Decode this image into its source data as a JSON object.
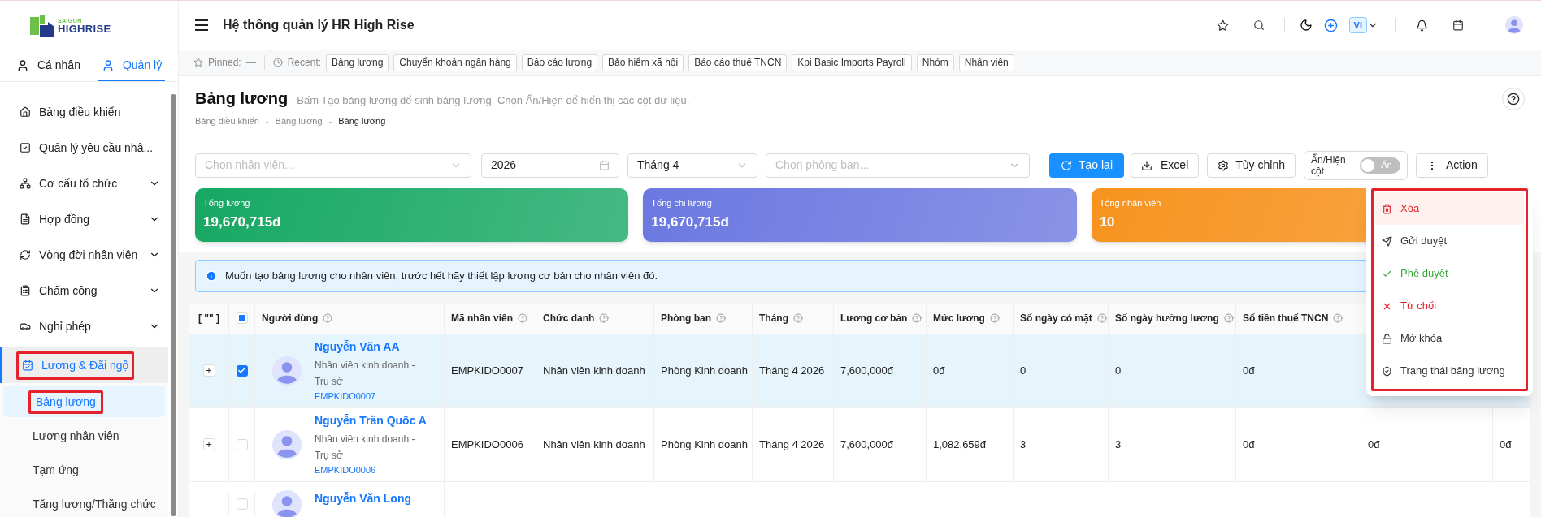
{
  "sidebar": {
    "logo": {
      "line1": "SAIGON",
      "line2": "HIGHRISE"
    },
    "tabs": [
      {
        "label": "Cá nhân",
        "selected": false
      },
      {
        "label": "Quản lý",
        "selected": true
      }
    ],
    "items": [
      {
        "label": "Bảng điều khiển"
      },
      {
        "label": "Quản lý yêu cầu nhâ...",
        "expanded": false
      },
      {
        "label": "Cơ cấu tổ chức",
        "expanded": false
      },
      {
        "label": "Hợp đồng",
        "expanded": false
      },
      {
        "label": "Vòng đời nhân viên",
        "expanded": false
      },
      {
        "label": "Chấm công",
        "expanded": false
      },
      {
        "label": "Nghỉ phép",
        "expanded": false
      },
      {
        "label": "Lương & Đãi ngộ",
        "expanded": true,
        "children": [
          {
            "label": "Bảng lương",
            "selected": true
          },
          {
            "label": "Lương nhân viên",
            "selected": false
          },
          {
            "label": "Tạm ứng",
            "selected": false
          },
          {
            "label": "Tăng lương/Thăng chức",
            "selected": false
          }
        ]
      }
    ]
  },
  "header": {
    "title": "Hệ thống quản lý HR High Rise",
    "language": "VI"
  },
  "pinned": {
    "label": "Pinned:",
    "value": "—"
  },
  "recent": {
    "label": "Recent:",
    "items": [
      "Bảng lương",
      "Chuyển khoản ngân hàng",
      "Báo cáo lương",
      "Bảo hiểm xã hội",
      "Báo cáo thuế TNCN",
      "Kpi Basic Imports Payroll",
      "Nhóm",
      "Nhân viên"
    ]
  },
  "page": {
    "title": "Bảng lương",
    "hint": "Bấm Tạo bảng lương để sinh bảng lương. Chọn Ẩn/Hiện để hiển thị các cột dữ liệu.",
    "breadcrumb": [
      "Bảng điều khiển",
      "Bảng lương",
      "Bảng lương"
    ],
    "breadcrumb_separator": "-"
  },
  "filters": {
    "employee": {
      "placeholder": "Chọn nhân viên..."
    },
    "year": {
      "value": "2026"
    },
    "month": {
      "value": "Tháng 4"
    },
    "department": {
      "placeholder": "Chọn phòng ban..."
    }
  },
  "buttons": {
    "regenerate": "Tạo lại",
    "excel": "Excel",
    "customize": "Tùy chỉnh",
    "action": "Action"
  },
  "column_toggle": {
    "label": "Ẩn/Hiện cột",
    "on": false,
    "switch_text": "Ẩn"
  },
  "cards": [
    {
      "label": "Tổng lương",
      "value": "19,670,715đ",
      "color": "#17a863"
    },
    {
      "label": "Tổng chi lương",
      "value": "19,670,715đ",
      "color": "#6b78e0"
    },
    {
      "label": "Tổng nhân viên",
      "value": "10",
      "color": "#f7931e"
    }
  ],
  "alert": "Muốn tạo bảng lương cho nhân viên, trước hết hãy thiết lập lương cơ bản cho nhân viên đó.",
  "action_menu": [
    {
      "label": "Xóa",
      "kind": "danger",
      "highlighted": true
    },
    {
      "label": "Gửi duyệt",
      "kind": "default",
      "highlighted": false
    },
    {
      "label": "Phê duyệt",
      "kind": "success",
      "highlighted": false
    },
    {
      "label": "Từ chối",
      "kind": "danger",
      "highlighted": false
    },
    {
      "label": "Mở khóa",
      "kind": "default",
      "highlighted": false
    },
    {
      "label": "Trạng thái bảng lương",
      "kind": "default",
      "highlighted": false
    }
  ],
  "table": {
    "expand_header": "[ \"\" ]",
    "header_checkbox": {
      "indeterminate": true
    },
    "columns": [
      "Người dùng",
      "Mã nhân viên",
      "Chức danh",
      "Phòng ban",
      "Tháng",
      "Lương cơ bản",
      "Mức lương",
      "Số ngày có mặt",
      "Số ngày hưởng lương",
      "Số tiền thuế TNCN"
    ],
    "rows": [
      {
        "expander": "+",
        "checked": true,
        "selected": true,
        "name": "Nguyễn Văn AA",
        "subtitle": "Nhân viên kinh doanh - Trụ sở",
        "code": "EMPKIDO0007",
        "cells": [
          "EMPKIDO0007",
          "Nhân viên kinh doanh",
          "Phòng Kinh doanh",
          "Tháng 4 2026",
          "7,600,000đ",
          "0đ",
          "0",
          "0",
          "0đ"
        ]
      },
      {
        "expander": "+",
        "checked": false,
        "selected": false,
        "name": "Nguyễn Trần Quốc A",
        "subtitle": "Nhân viên kinh doanh - Trụ sở",
        "code": "EMPKIDO0006",
        "cells": [
          "EMPKIDO0006",
          "Nhân viên kinh doanh",
          "Phòng Kinh doanh",
          "Tháng 4 2026",
          "7,600,000đ",
          "1,082,659đ",
          "3",
          "3",
          "0đ",
          "0đ",
          "0đ"
        ]
      },
      {
        "checked": false,
        "selected": false,
        "name": "Nguyễn Văn Long"
      }
    ]
  }
}
